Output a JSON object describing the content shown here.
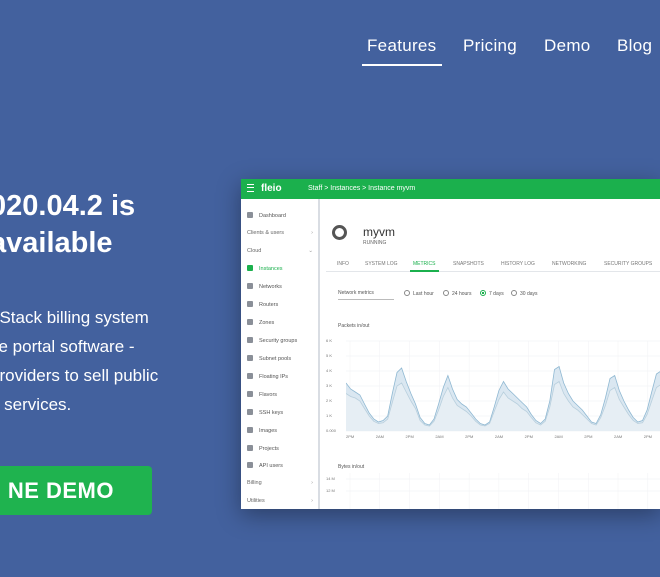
{
  "nav": {
    "items": [
      {
        "label": "Features",
        "active": true
      },
      {
        "label": "Pricing"
      },
      {
        "label": "Demo"
      },
      {
        "label": "Blog"
      }
    ]
  },
  "hero": {
    "title_line1": "020.04.2 is",
    "title_line2": "available",
    "desc_line1": "nStack billing system",
    "desc_line2": "ce portal software -",
    "desc_line3": "providers to sell public",
    "desc_line4": "d services.",
    "cta_label": "NE DEMO"
  },
  "app": {
    "brand": "fleio",
    "breadcrumb": "Staff > Instances > Instance myvm",
    "sidebar": [
      {
        "label": "Dashboard",
        "icon": "dashboard-icon"
      },
      {
        "label": "Clients & users",
        "group": true
      },
      {
        "label": "Cloud",
        "group": true
      },
      {
        "label": "Instances",
        "icon": "instances-icon",
        "active": true
      },
      {
        "label": "Networks",
        "icon": "networks-icon"
      },
      {
        "label": "Routers",
        "icon": "routers-icon"
      },
      {
        "label": "Zones",
        "icon": "zones-icon"
      },
      {
        "label": "Security groups",
        "icon": "shield-icon"
      },
      {
        "label": "Subnet pools",
        "icon": "subnet-icon"
      },
      {
        "label": "Floating IPs",
        "icon": "floating-ip-icon"
      },
      {
        "label": "Flavors",
        "icon": "flavors-icon"
      },
      {
        "label": "SSH keys",
        "icon": "key-icon"
      },
      {
        "label": "Images",
        "icon": "images-icon"
      },
      {
        "label": "Projects",
        "icon": "projects-icon"
      },
      {
        "label": "API users",
        "icon": "api-users-icon"
      },
      {
        "label": "Billing",
        "group": true
      },
      {
        "label": "Utilities",
        "group": true
      }
    ],
    "instance": {
      "name": "myvm",
      "status": "RUNNING"
    },
    "tabs": [
      "INFO",
      "SYSTEM LOG",
      "METRICS",
      "SNAPSHOTS",
      "HISTORY LOG",
      "NETWORKING",
      "SECURITY GROUPS"
    ],
    "active_tab": "METRICS",
    "filter": {
      "select_label": "Network metrics",
      "options": [
        "Last hour",
        "24 hours",
        "7 days",
        "30 days"
      ],
      "selected": "7 days"
    },
    "accent_color": "#1bb04d"
  },
  "chart_data": [
    {
      "type": "area",
      "title": "Packets in/out",
      "yticks": [
        "6 K",
        "5 K",
        "4 K",
        "3 K",
        "2 K",
        "1 K",
        "0.000"
      ],
      "ylim": [
        0,
        6000
      ],
      "xticks": [
        "2PM",
        "2AM",
        "2PM",
        "2AM",
        "2PM",
        "2AM",
        "2PM",
        "2AM",
        "2PM",
        "2AM",
        "2PM"
      ],
      "series": [
        {
          "values": [
            3200,
            2800,
            2600,
            2400,
            1800,
            1200,
            800,
            600,
            700,
            1000,
            2500,
            3900,
            4200,
            3300,
            2500,
            1800,
            900,
            500,
            400,
            800,
            1800,
            2900,
            3700,
            2800,
            2100,
            1800,
            1600,
            1200,
            800,
            500,
            400,
            600,
            1600,
            2700,
            3300,
            2800,
            2500,
            2200,
            1900,
            1600,
            1100,
            700,
            500,
            800,
            2000,
            4100,
            4300,
            3200,
            2500,
            2000,
            1700,
            1400,
            1000,
            600,
            500,
            1100,
            2200,
            3500,
            3700,
            2700,
            2000,
            1400,
            900,
            600,
            700,
            1400,
            2600,
            3800,
            4000
          ]
        },
        {
          "values": [
            2500,
            2300,
            2200,
            2000,
            1500,
            1000,
            650,
            500,
            550,
            800,
            1900,
            3000,
            3200,
            2600,
            2000,
            1500,
            700,
            400,
            330,
            650,
            1400,
            2300,
            2900,
            2200,
            1700,
            1500,
            1300,
            1000,
            650,
            400,
            330,
            500,
            1300,
            2100,
            2600,
            2200,
            2000,
            1800,
            1500,
            1300,
            900,
            550,
            400,
            650,
            1600,
            3100,
            3300,
            2500,
            2000,
            1600,
            1400,
            1100,
            800,
            500,
            400,
            900,
            1700,
            2700,
            2900,
            2100,
            1600,
            1100,
            700,
            500,
            550,
            1100,
            2000,
            2900,
            3100
          ]
        }
      ]
    },
    {
      "type": "area",
      "title": "Bytes in/out",
      "yticks": [
        "14 M",
        "12 M"
      ],
      "series": []
    }
  ]
}
